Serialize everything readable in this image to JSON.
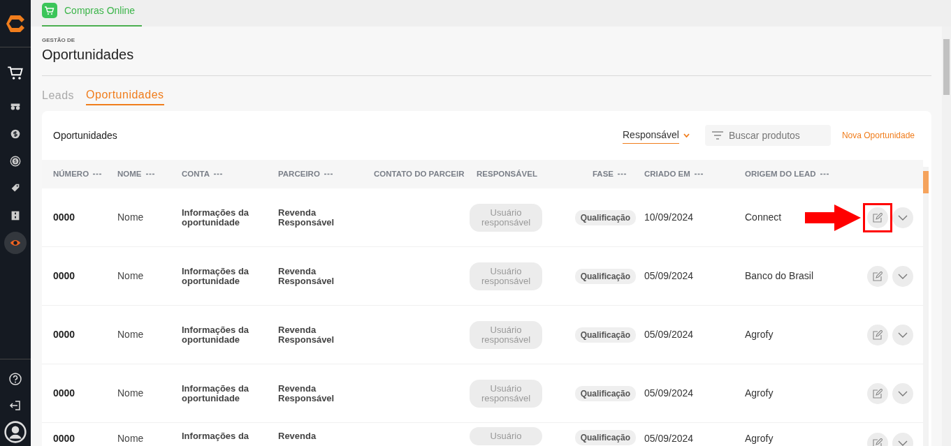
{
  "sidebar": {
    "items": [
      {
        "kind": "cart",
        "selected": false
      },
      {
        "kind": "tractor",
        "selected": false
      },
      {
        "kind": "coin",
        "selected": false
      },
      {
        "kind": "exchange",
        "selected": false
      },
      {
        "kind": "tag",
        "selected": false
      },
      {
        "kind": "building",
        "selected": false
      },
      {
        "kind": "eye",
        "selected": true
      }
    ],
    "footer": [
      {
        "kind": "help"
      },
      {
        "kind": "logout"
      },
      {
        "kind": "user"
      }
    ]
  },
  "app_tab": {
    "label": "Compras Online"
  },
  "page": {
    "overline": "GESTÃO DE",
    "title": "Oportunidades"
  },
  "tabs": [
    {
      "label": "Leads",
      "selected": false
    },
    {
      "label": "Oportunidades",
      "selected": true
    }
  ],
  "card": {
    "title": "Oportunidades",
    "filter": "Responsável",
    "search": {
      "placeholder": "Buscar produtos"
    },
    "new_button": "Nova Oportunidade"
  },
  "table": {
    "columns": [
      {
        "label": "NÚMERO",
        "menu": true
      },
      {
        "label": "NOME",
        "menu": true
      },
      {
        "label": "CONTA",
        "menu": true
      },
      {
        "label": "PARCEIRO",
        "menu": true
      },
      {
        "label": "CONTATO DO PARCEIR",
        "menu": false
      },
      {
        "label": "RESPONSÁVEL",
        "menu": false
      },
      {
        "label": "FASE",
        "menu": true
      },
      {
        "label": "CRIADO EM",
        "menu": true
      },
      {
        "label": "ORIGEM DO LEAD",
        "menu": true
      }
    ],
    "rows": [
      {
        "numero": "0000",
        "nome": "Nome",
        "conta": "Informações da oportunidade",
        "parceiro": "Revenda Responsável",
        "responsavel": "Usuário responsável",
        "fase": "Qualificação",
        "criado": "10/09/2024",
        "origem": "Connect",
        "highlighted": true
      },
      {
        "numero": "0000",
        "nome": "Nome",
        "conta": "Informações da oportunidade",
        "parceiro": "Revenda Responsável",
        "responsavel": "Usuário responsável",
        "fase": "Qualificação",
        "criado": "05/09/2024",
        "origem": "Banco do Brasil",
        "highlighted": false
      },
      {
        "numero": "0000",
        "nome": "Nome",
        "conta": "Informações da oportunidade",
        "parceiro": "Revenda Responsável",
        "responsavel": "Usuário responsável",
        "fase": "Qualificação",
        "criado": "05/09/2024",
        "origem": "Agrofy",
        "highlighted": false
      },
      {
        "numero": "0000",
        "nome": "Nome",
        "conta": "Informações da oportunidade",
        "parceiro": "Revenda Responsável",
        "responsavel": "Usuário responsável",
        "fase": "Qualificação",
        "criado": "05/09/2024",
        "origem": "Agrofy",
        "highlighted": false
      },
      {
        "numero": "0000",
        "nome": "Nome",
        "conta": "Informações da",
        "parceiro": "Revenda",
        "responsavel": "Usuário",
        "fase": "Qualificação",
        "criado": "05/09/2024",
        "origem": "Agrofy",
        "highlighted": false
      }
    ]
  }
}
